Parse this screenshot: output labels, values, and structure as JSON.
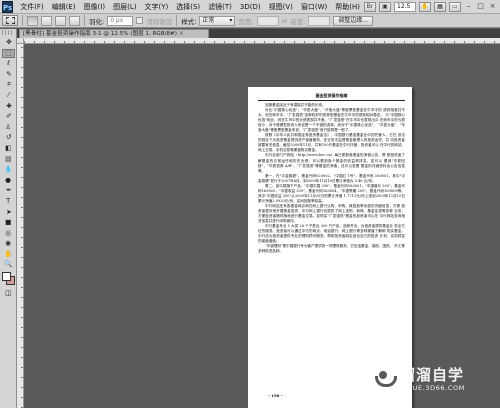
{
  "menubar": {
    "logo": "Ps",
    "items": [
      "文件(F)",
      "编辑(E)",
      "图像(I)",
      "图层(L)",
      "文字(Y)",
      "选择(S)",
      "滤镜(T)",
      "3D(D)",
      "视图(V)",
      "窗口(W)",
      "帮助(H)"
    ],
    "zoom_value": "12.5",
    "minimize": "–",
    "maximize": "□",
    "close": "×"
  },
  "options": {
    "feather_label": "羽化:",
    "feather_value": "0 px",
    "antialias_label": "消除锯齿",
    "style_label": "样式:",
    "style_value": "正常",
    "width_label": "宽度:",
    "height_label": "高度:",
    "refine_button": "调整边缘..."
  },
  "document_tab": {
    "title": "[黑骨柱] 基金投资操作指南 3-1 @ 12.5% (图层 1, RGB/8#)",
    "close": "×"
  },
  "toolbox": {
    "foreground_color": "#ffffff",
    "background_color": "#d59a9a"
  },
  "page": {
    "header": "基金投资操作指南",
    "paragraphs": [
      "回报基金接近于有潜能并不能的长线。",
      "对比\"中国核心优选\"、\"华夏大盘\"、\"华宝大盘\"等股票型基金在牛市中的 绩效相差并不大，但在熊市中，\"广发强债\"这种较好的债券型基金在牛市中的绩效相对稳定， 与\"中国核心优选\"相比，其在牛市中的业绩表现并不差。\"广发强债\"在牛市中也表现出众 在熊市中的亏损较小，对于稳健型投资人来说是一个不错的选择，而对于\"中国核心优选\"、 \"华夏大盘\"、\"华宝大盘\"等股票型基金来说，\"广发强债\"就只能算是一般了。",
      "按照《中华人民共和国证券投资基金法》，中国银行基金基金业中的托管人，它在 该法的规定下为投资基金提供资产保管服务，在业务中监督基金管理人的投资运作，并 向投资者披露有关信息。截至2009年11月，共有100只基金在中行托管，投资者可以 在中行的网站、网上交易、手机交易等渠道购买基金。",
      "中行全部门户网站（http://www.boc.cn）每日更新各基金的净值公告，帮 助投资者了解基金的日常运作和历史业绩。可以看到各个基金的收益率排名，如可以 看到\"华夏回报\"、\"华夏债券 A/B\"、\"广发强债\"等基金的净值，还可以查看 基金的详细资料及公告信息等。",
      "第一，在\"中金稳健\"，基金代码020002，\"中国红 1号\"，基金代码 160001。其中\"中金稳健\"发行于2007年6月，到2009年11月10日累计净值为 3.46 元/份。",
      "第二，如中银旗下产品：\"中银中国 200\"，基金代码163801，\"中银增长 200\"，基金代码163803，\"中银收益 200\"，基金代码163804，\"中银策略 200\"，基金代码163805等。其中\"中银收益 200\"从2009年11月28日的累计净值 1.7713元/份上涨到2009年11月10日累计净值2.0920元/份，区间回报率较高。",
      "中行网站还有各基金网点和在网上银行认购、申购、赎回费率优惠的详细信息，方便 投资者更好地开展基金投资，中行网上银行也提供了网上选购、转换、基金定投等多种 业务，方便投资者随时随地进行基金交易。如购买\"广发强债\"基金的投资者可以在 中行网站查询相关信息并进行申购操作。",
      "中行基金专业 5 大类 26 个子类近 300 只产品，品种齐全，为投资者提供基金业 务全方位的服务。投资者可以通过中行的网点、电话银行、网上银行等多种渠道了解和 购买基金，中行还为投资者提供专业的理财顾问服务，帮助投资者制定适合自己的投资 计划，实现财富的保值增值。",
      "\"中银理财\"是中国银行专为客户提供的一项理财服务，它包括基金、保险、国债、 外汇等多种投资品种。"
    ],
    "page_number": "- 198 -"
  },
  "watermark": {
    "title": "溜溜自学",
    "url": "ZIXUE.3D66.COM"
  }
}
